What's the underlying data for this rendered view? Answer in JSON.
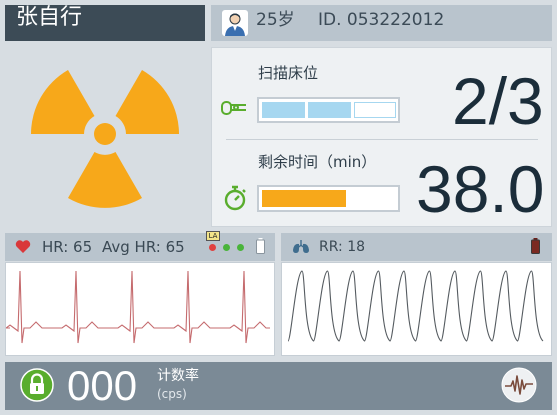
{
  "patient": {
    "name": "张自行",
    "age": "25岁",
    "id": "ID. 053222012"
  },
  "scan": {
    "bed_label": "扫描床位",
    "bed_value": "2/3",
    "bed_progress": {
      "completed_segments": 2,
      "total_segments": 3
    },
    "time_label": "剩余时间（min）",
    "time_value": "38.0",
    "time_progress_fraction": 0.63
  },
  "ecg": {
    "hr_text": "HR: 65",
    "avg_hr_text": "Avg HR: 65",
    "lead_badge": "LA"
  },
  "resp": {
    "rr_text": "RR: 18"
  },
  "footer": {
    "count_value": "000",
    "count_label": "计数率",
    "count_unit": "(cps)"
  },
  "colors": {
    "accent_green": "#59ad2d",
    "accent_orange": "#f7a81a",
    "progress_blue": "#a6d7f0",
    "dark_header": "#3c4b56",
    "heart_red": "#d9383a"
  },
  "icons": [
    "avatar-icon",
    "radiation-icon",
    "bed-icon",
    "stopwatch-icon",
    "heart-icon",
    "lungs-icon",
    "battery-icon",
    "lock-icon",
    "waveform-icon"
  ]
}
